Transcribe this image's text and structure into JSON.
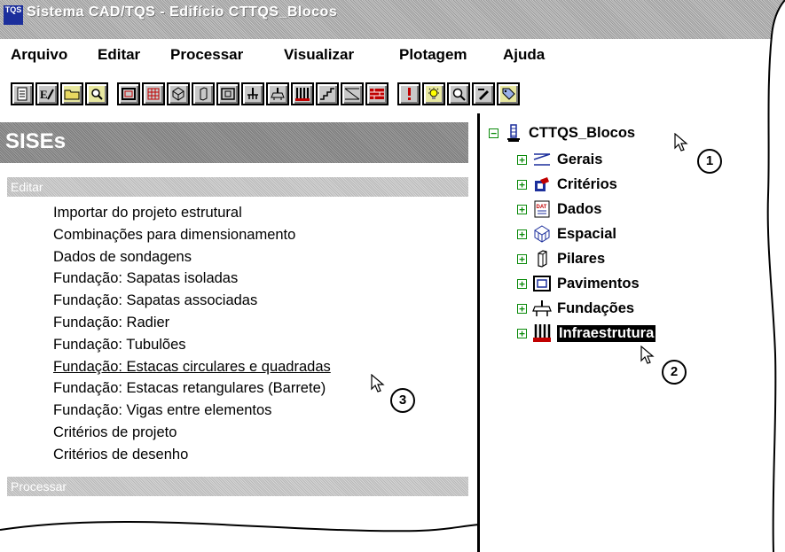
{
  "window": {
    "app_icon_text": "TQS",
    "title": "Sistema CAD/TQS - Edifício CTTQS_Blocos"
  },
  "menubar": [
    "Arquivo",
    "Editar",
    "Processar",
    "Visualizar",
    "Plotagem",
    "Ajuda"
  ],
  "toolbar_icons": [
    "document-icon",
    "edit-file-icon",
    "folder-icon",
    "preview-icon",
    "frame-icon",
    "grid-icon",
    "spatial-icon",
    "pillar-icon",
    "floor-plan-icon",
    "foundation-icon",
    "foundation-cap-icon",
    "infrastructure-icon",
    "stairs-icon",
    "ramp-icon",
    "brick-wall-icon",
    "alert-icon",
    "lightbulb-icon",
    "zoom-icon",
    "edit-icon",
    "tag-icon"
  ],
  "left_panel": {
    "title": "SISEs",
    "section_edit": "Editar",
    "section_process": "Processar",
    "items": [
      "Importar do projeto estrutural",
      "Combinações para dimensionamento",
      "Dados de sondagens",
      "Fundação: Sapatas isoladas",
      "Fundação: Sapatas associadas",
      "Fundação: Radier",
      "Fundação: Tubulões",
      "Fundação: Estacas circulares e quadradas",
      "Fundação: Estacas retangulares (Barrete)",
      "Fundação: Vigas entre elementos",
      "Critérios de projeto",
      "Critérios de desenho"
    ]
  },
  "tree": {
    "root": "CTTQS_Blocos",
    "expand_symbol": "+",
    "collapse_symbol": "−",
    "items": [
      {
        "label": "Gerais",
        "icon": "general-icon"
      },
      {
        "label": "Critérios",
        "icon": "criteria-icon"
      },
      {
        "label": "Dados",
        "icon": "data-icon"
      },
      {
        "label": "Espacial",
        "icon": "spatial-icon"
      },
      {
        "label": "Pilares",
        "icon": "pillar-icon"
      },
      {
        "label": "Pavimentos",
        "icon": "floor-icon"
      },
      {
        "label": "Fundações",
        "icon": "foundation-icon"
      },
      {
        "label": "Infraestrutura",
        "icon": "infrastructure-icon",
        "selected": true
      }
    ]
  },
  "callouts": [
    "1",
    "2",
    "3"
  ],
  "data_icon_text": "DAT",
  "colors": {
    "selection": "#000000",
    "tree_expander": "#0a8a0a",
    "icon_blue": "#1c2f9c",
    "icon_red": "#c00000"
  }
}
